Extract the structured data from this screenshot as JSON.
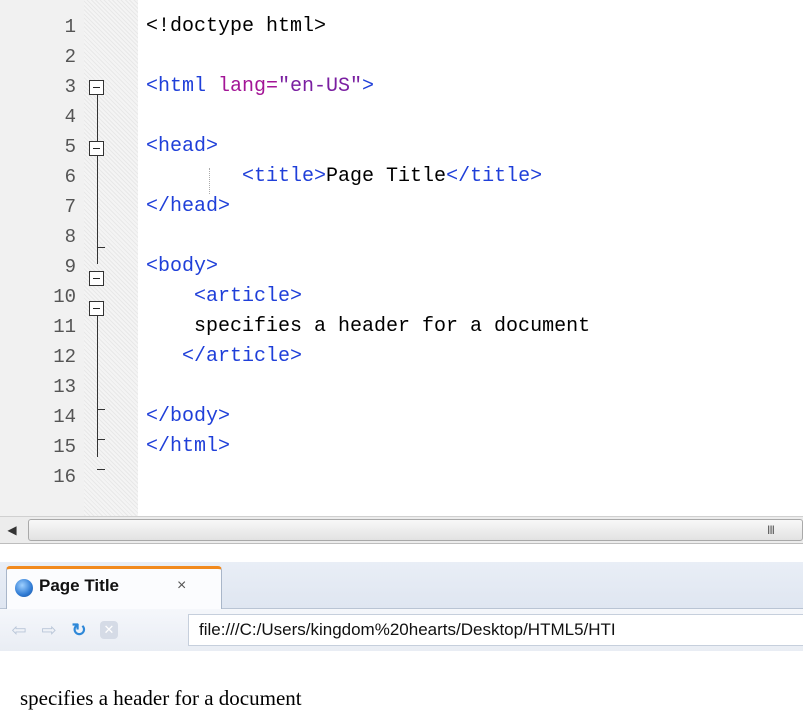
{
  "editor": {
    "lines": [
      {
        "n": "1",
        "parts": [
          {
            "t": "<!doctype html>",
            "c": "txt"
          }
        ]
      },
      {
        "n": "2",
        "parts": []
      },
      {
        "n": "3",
        "parts": [
          {
            "t": "<html ",
            "c": "tag"
          },
          {
            "t": "lang=",
            "c": "attr"
          },
          {
            "t": "\"en-US\"",
            "c": "val"
          },
          {
            "t": ">",
            "c": "tag"
          }
        ]
      },
      {
        "n": "4",
        "parts": []
      },
      {
        "n": "5",
        "parts": [
          {
            "t": "<head>",
            "c": "tag"
          }
        ]
      },
      {
        "n": "6",
        "parts": [
          {
            "t": "        <title>",
            "c": "tag"
          },
          {
            "t": "Page Title",
            "c": "txt"
          },
          {
            "t": "</title>",
            "c": "tag"
          }
        ]
      },
      {
        "n": "7",
        "parts": [
          {
            "t": "</head>",
            "c": "tag"
          }
        ]
      },
      {
        "n": "8",
        "parts": []
      },
      {
        "n": "9",
        "parts": [
          {
            "t": "<body>",
            "c": "tag"
          }
        ]
      },
      {
        "n": "10",
        "parts": [
          {
            "t": "    <article>",
            "c": "tag"
          }
        ]
      },
      {
        "n": "11",
        "parts": [
          {
            "t": "    specifies a header for a document",
            "c": "txt"
          }
        ]
      },
      {
        "n": "12",
        "parts": [
          {
            "t": "   </article>",
            "c": "tag"
          }
        ]
      },
      {
        "n": "13",
        "parts": []
      },
      {
        "n": "14",
        "parts": [
          {
            "t": "</body>",
            "c": "tag"
          }
        ]
      },
      {
        "n": "15",
        "parts": [
          {
            "t": "</html>",
            "c": "tag"
          }
        ]
      },
      {
        "n": "16",
        "parts": []
      }
    ],
    "scroll_grip": "III",
    "scroll_left_arrow": "◀"
  },
  "browser": {
    "tab_title": "Page Title",
    "tab_close": "×",
    "back_icon": "⇦",
    "forward_icon": "⇨",
    "reload_icon": "↻",
    "stop_icon": "✕",
    "address": "file:///C:/Users/kingdom%20hearts/Desktop/HTML5/HTI",
    "page_text": "specifies a header for a document"
  },
  "colors": {
    "tag": "#1f3fd9",
    "attr": "#a31596",
    "tab_accent": "#f18a1e"
  }
}
